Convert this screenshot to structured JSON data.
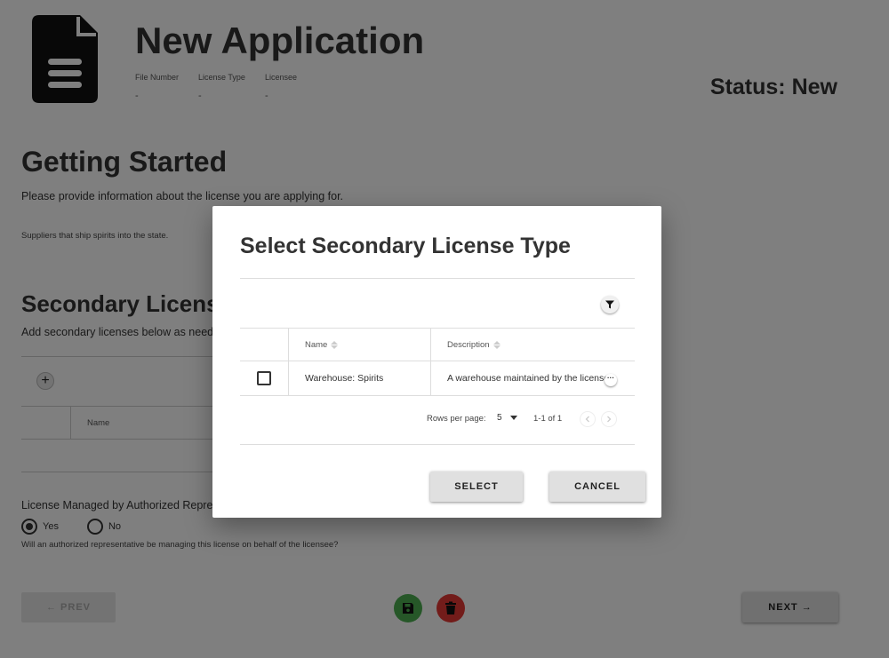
{
  "header": {
    "title": "New Application",
    "meta": [
      {
        "label": "File Number",
        "value": "-"
      },
      {
        "label": "License Type",
        "value": "-"
      },
      {
        "label": "Licensee",
        "value": "-"
      }
    ],
    "status": "Status: New",
    "icon": "document-icon"
  },
  "getting_started": {
    "heading": "Getting Started",
    "intro": "Please provide information about the license you are applying for.",
    "license_description": "Suppliers that ship spirits into the state."
  },
  "secondary": {
    "heading": "Secondary License",
    "subtext": "Add secondary licenses below as need",
    "add_button": "+",
    "name_column": "Name"
  },
  "authorized": {
    "label": "License Managed by Authorized Repres",
    "yes": "Yes",
    "no": "No",
    "selected": "Yes",
    "help": "Will an authorized representative be managing this license on behalf of the licensee?"
  },
  "footer": {
    "prev": "← PREV",
    "next": "NEXT →",
    "save_icon": "floppy-disk-icon",
    "delete_icon": "trash-icon",
    "colors": {
      "save": "#4caf50",
      "delete": "#e53935"
    }
  },
  "dialog": {
    "title": "Select Secondary License Type",
    "filter_icon": "filter-icon",
    "columns": [
      "Name",
      "Description"
    ],
    "rows": [
      {
        "name": "Warehouse: Spirits",
        "description": "A warehouse maintained by the licensee",
        "checked": false
      }
    ],
    "more_label": "···",
    "pagination": {
      "rows_per_page_label": "Rows per page:",
      "rows_per_page": "5",
      "range": "1-1 of 1"
    },
    "select_button": "SELECT",
    "cancel_button": "CANCEL"
  }
}
